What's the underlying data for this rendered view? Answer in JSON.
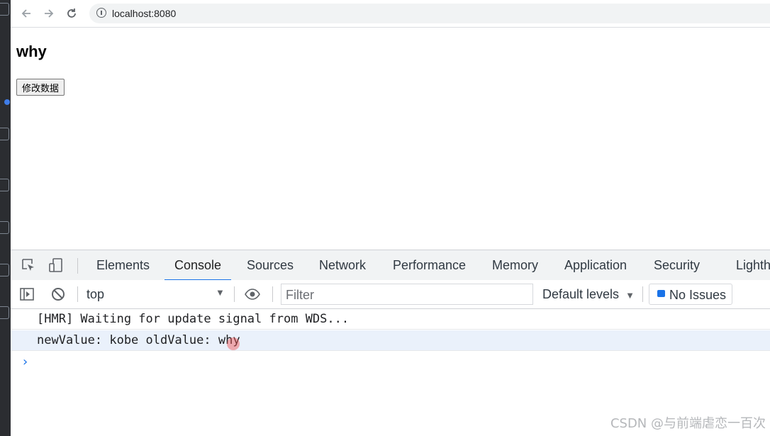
{
  "browser": {
    "url": "localhost:8080"
  },
  "page": {
    "title": "why",
    "button_label": "修改数据"
  },
  "devtools": {
    "tabs": [
      {
        "label": "Elements"
      },
      {
        "label": "Console",
        "active": true
      },
      {
        "label": "Sources"
      },
      {
        "label": "Network"
      },
      {
        "label": "Performance"
      },
      {
        "label": "Memory"
      },
      {
        "label": "Application"
      },
      {
        "label": "Security"
      },
      {
        "label": "Lighth"
      }
    ],
    "context": "top",
    "filter_placeholder": "Filter",
    "levels_label": "Default levels",
    "issues_label": "No Issues",
    "accent_color": "#1a73e8"
  },
  "console": {
    "lines": [
      "[HMR] Waiting for update signal from WDS...",
      "newValue: kobe oldValue: why"
    ],
    "prompt": "›"
  },
  "watermark": "CSDN @与前端虐恋一百次"
}
